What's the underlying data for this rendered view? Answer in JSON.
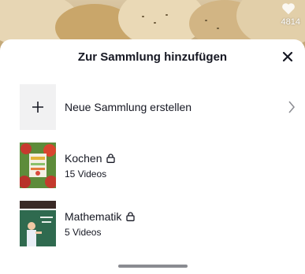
{
  "background": {
    "like_count": "4814",
    "heart_icon": "heart-icon"
  },
  "sheet": {
    "title": "Zur Sammlung hinzufügen",
    "close_icon": "close-icon",
    "new_collection": {
      "label": "Neue Sammlung erstellen",
      "icon": "plus-icon",
      "chevron": "chevron-right-icon"
    },
    "collections": [
      {
        "name": "Kochen",
        "count": "15 Videos",
        "private_icon": "lock-icon"
      },
      {
        "name": "Mathematik",
        "count": "5 Videos",
        "private_icon": "lock-icon"
      }
    ]
  },
  "colors": {
    "text": "#161823",
    "plus_bg": "#f1f1f2",
    "indicator": "#8a8b91"
  }
}
